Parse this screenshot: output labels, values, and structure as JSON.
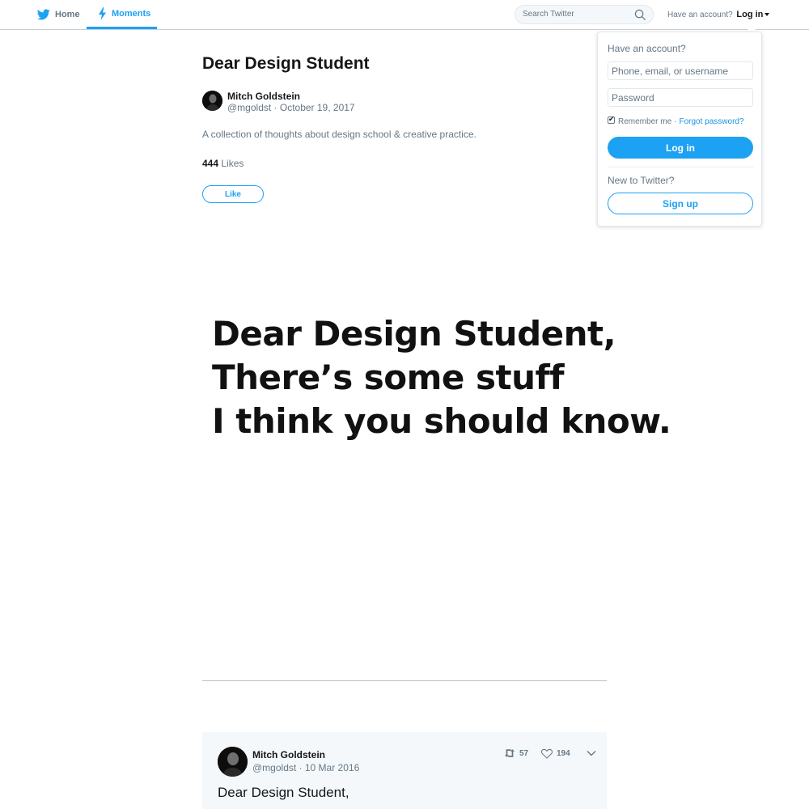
{
  "nav": {
    "home_label": "Home",
    "moments_label": "Moments",
    "search_placeholder": "Search Twitter",
    "have_account": "Have an account?",
    "login_label": "Log in"
  },
  "login_dropdown": {
    "title": "Have an account?",
    "phone_placeholder": "Phone, email, or username",
    "password_placeholder": "Password",
    "remember_label": "Remember me",
    "separator": "·",
    "forgot_label": "Forgot password?",
    "login_button": "Log in",
    "new_label": "New to Twitter?",
    "signup_button": "Sign up",
    "remember_checked": true
  },
  "moment": {
    "title": "Dear Design Student",
    "author_name": "Mitch Goldstein",
    "author_meta": "@mgoldst · October 19, 2017",
    "description": "A collection of thoughts about design school & creative practice.",
    "likes_count": "444",
    "likes_label": "Likes",
    "like_button": "Like"
  },
  "cover": {
    "line1": "Dear Design Student,",
    "line2": "There’s some stuff",
    "line3": "I think you should know."
  },
  "tweet": {
    "author_name": "Mitch Goldstein",
    "author_meta": "@mgoldst · 10 Mar 2016",
    "retweets": "57",
    "likes": "194",
    "text": "Dear Design Student,"
  },
  "colors": {
    "accent": "#1da1f2",
    "secondary_text": "#657786",
    "tweet_bg": "#f5f8fa"
  }
}
